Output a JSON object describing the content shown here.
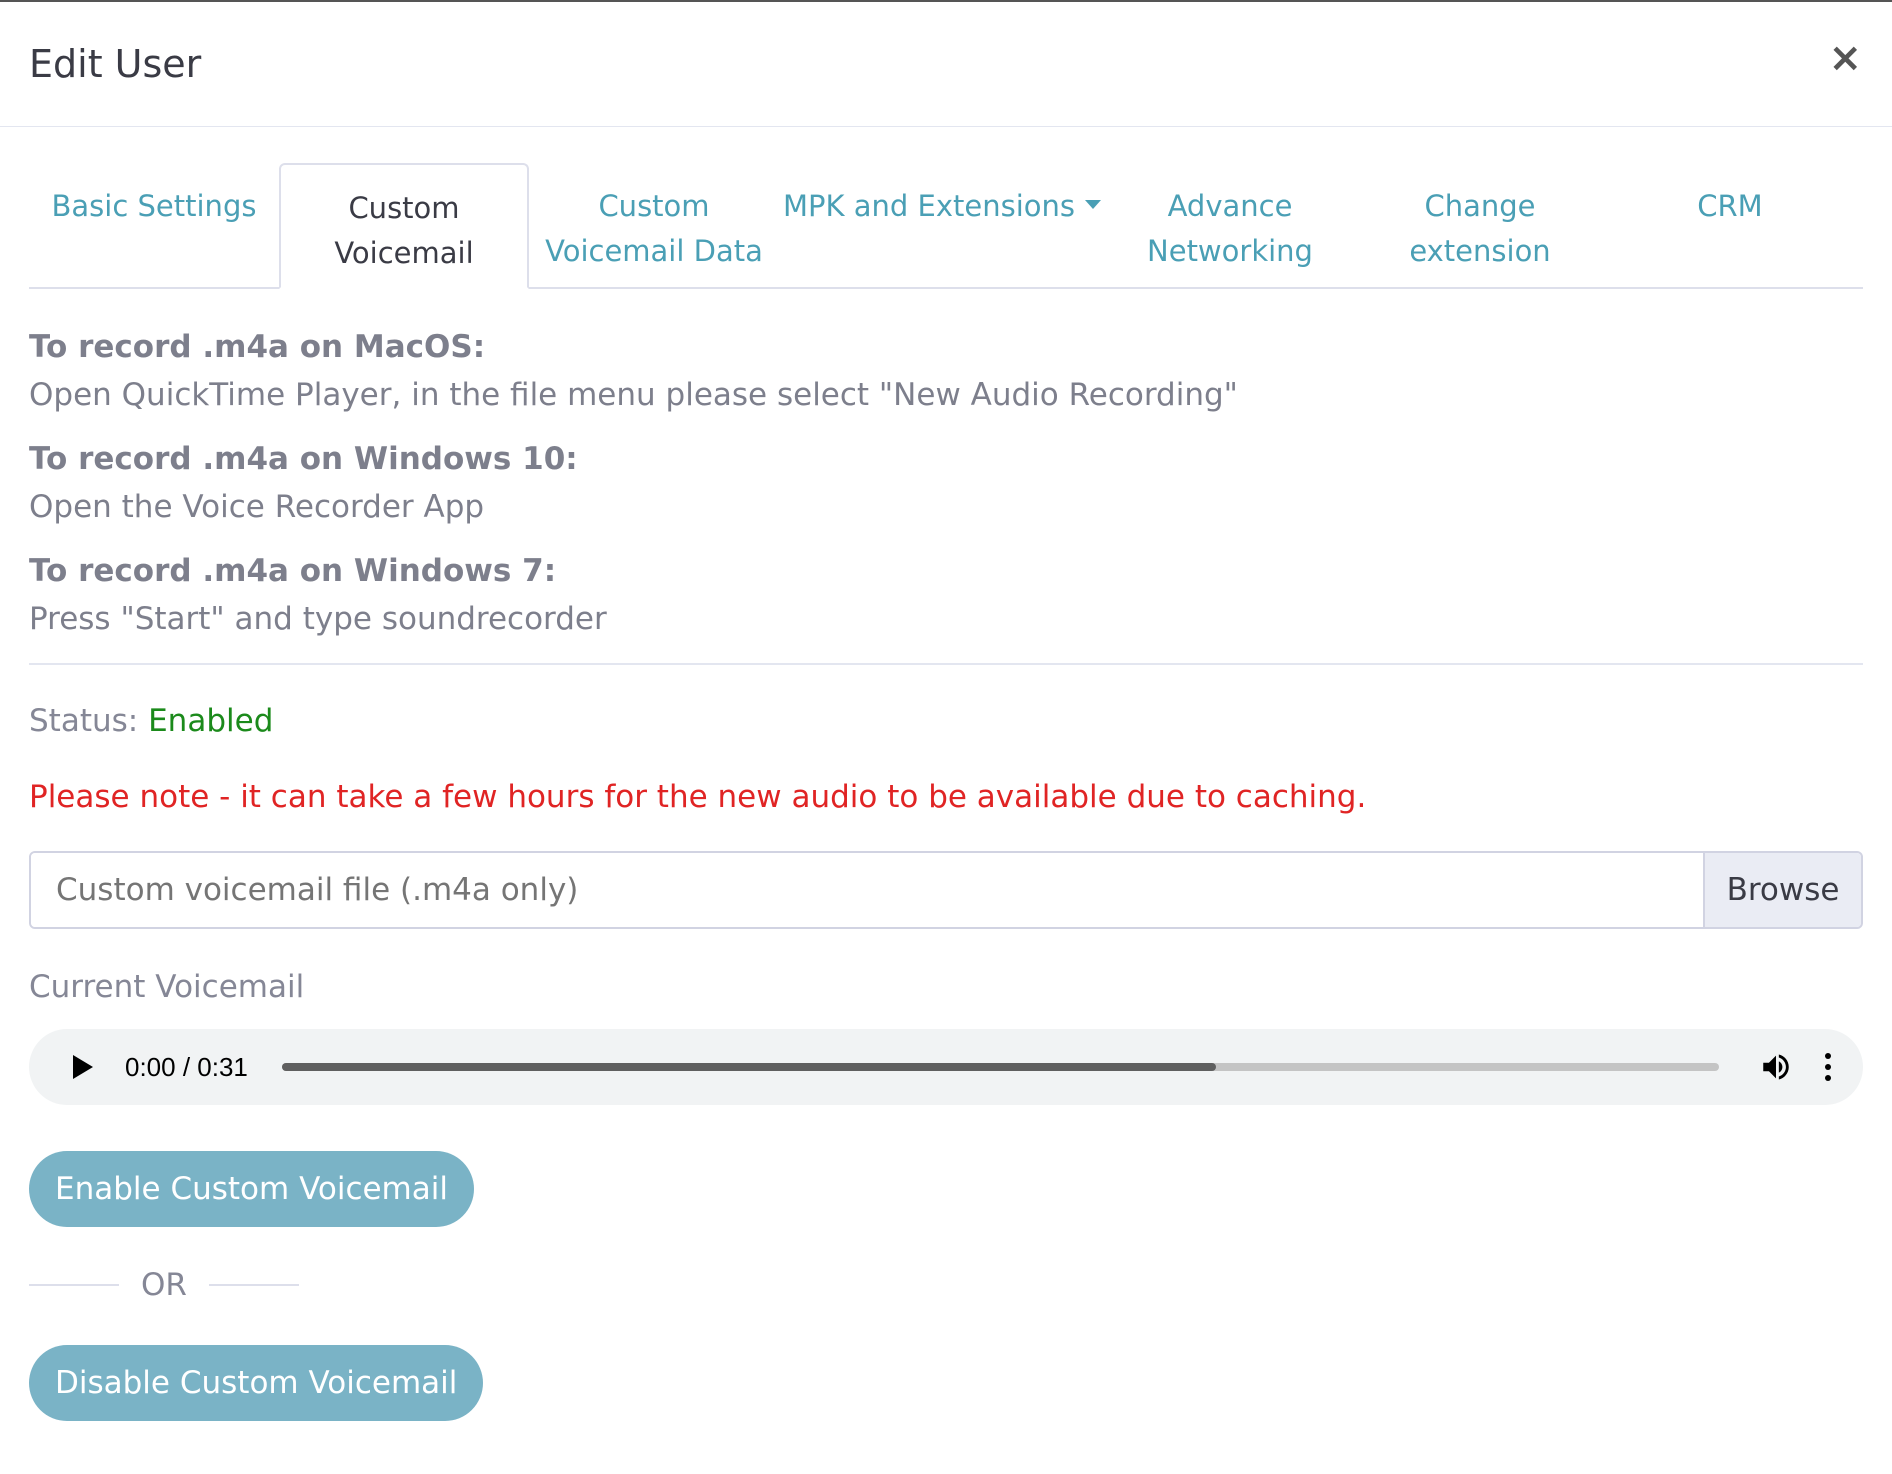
{
  "modal": {
    "title": "Edit User",
    "close_label": "×"
  },
  "tabs": [
    {
      "line1": "Basic Settings",
      "line2": ""
    },
    {
      "line1": "Custom",
      "line2": "Voicemail"
    },
    {
      "line1": "Custom",
      "line2": "Voicemail Data"
    },
    {
      "line1": "MPK and Extensions",
      "line2": ""
    },
    {
      "line1": "Advance",
      "line2": "Networking"
    },
    {
      "line1": "Change",
      "line2": "extension"
    },
    {
      "line1": "CRM",
      "line2": ""
    }
  ],
  "active_tab": "Custom Voicemail",
  "instructions": [
    {
      "title": "To record .m4a on MacOS:",
      "text": "Open QuickTime Player, in the file menu please select \"New Audio Recording\""
    },
    {
      "title": "To record .m4a on Windows 10:",
      "text": "Open the Voice Recorder App"
    },
    {
      "title": "To record .m4a on Windows 7:",
      "text": "Press \"Start\" and type soundrecorder"
    }
  ],
  "status": {
    "label": "Status:",
    "value": "Enabled",
    "value_color": "#1b8a1b"
  },
  "note": "Please note - it can take a few hours for the new audio to be available due to caching.",
  "file_input": {
    "placeholder": "Custom voicemail file (.m4a only)",
    "browse_label": "Browse"
  },
  "current_voicemail_label": "Current Voicemail",
  "audio_player": {
    "time": "0:00 / 0:31",
    "buffered_fraction": 0.65
  },
  "buttons": {
    "enable": "Enable Custom Voicemail",
    "or": "OR",
    "disable": "Disable Custom Voicemail"
  },
  "colors": {
    "accent": "#4a9fb5",
    "button": "#7ab3c6",
    "note": "#e02424"
  }
}
